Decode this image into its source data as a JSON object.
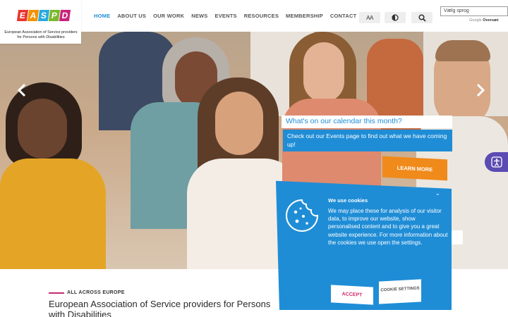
{
  "logo": {
    "letters": [
      "E",
      "A",
      "S",
      "P",
      "D"
    ],
    "tile_colors": [
      "#e8352e",
      "#f39200",
      "#2aa9e0",
      "#7ab929",
      "#c8237b"
    ],
    "subtitle": "European Association of Service providers for Persons with Disabilities"
  },
  "nav": {
    "items": [
      "HOME",
      "ABOUT US",
      "OUR WORK",
      "NEWS",
      "EVENTS",
      "RESOURCES",
      "MEMBERSHIP",
      "CONTACT"
    ],
    "active": "HOME"
  },
  "tools": {
    "font_size_label": "AA",
    "contrast_icon": "contrast-icon",
    "search_icon": "search-icon"
  },
  "translate": {
    "placeholder": "Vælg sprog",
    "credit_prefix": "Google",
    "credit_action": "Oversæt"
  },
  "hero": {
    "prev_icon": "chevron-left-icon",
    "next_icon": "chevron-right-icon",
    "calendar_title": "What's on our calendar this month?",
    "calendar_text": "Check out our Events page to find out what we have coming up!",
    "learn_more": "LEARN MORE"
  },
  "accessibility": {
    "icon": "accessibility-icon"
  },
  "cookie": {
    "title": "We use cookies",
    "text": "We may place these for analysis of our visitor data, to improve our website, show personalised content and to give you a great website experience. For more information about the cookies we use open the settings.",
    "accept": "ACCEPT",
    "settings": "COOKIE SETTINGS",
    "icon": "cookie-icon"
  },
  "intro": {
    "tag": "ALL ACROSS EUROPE",
    "title": "European Association of Service providers for Persons with Disabilities"
  },
  "colors": {
    "brand_blue": "#1f8dd6",
    "accent_orange": "#f08a1b",
    "accent_pink": "#c52a72",
    "a11y_purple": "#5c4bb3"
  }
}
